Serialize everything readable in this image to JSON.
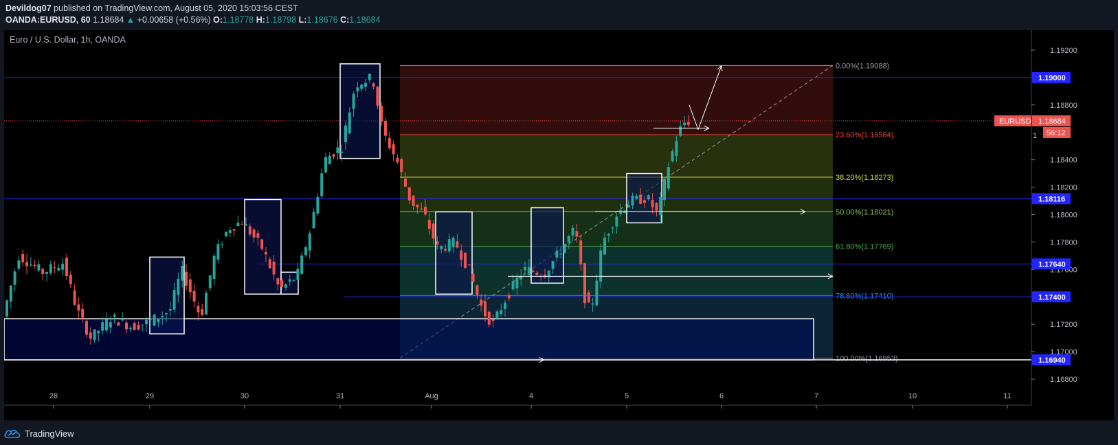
{
  "header": {
    "author": "Devildog07",
    "published_text": "published on TradingView.com, August 05, 2020 15:03:56 CEST",
    "symbol": "OANDA:EURUSD, 60",
    "last": "1.18684",
    "change": "+0.00658 (+0.56%)",
    "o_label": "O:",
    "o_value": "1.18778",
    "h_label": "H:",
    "h_value": "1.18798",
    "l_label": "L:",
    "l_value": "1.18676",
    "c_label": "C:",
    "c_value": "1.18684"
  },
  "chart": {
    "title": "Euro / U.S. Dollar, 1h, OANDA",
    "price_scale_labels": [
      "1.19200",
      "1.18800",
      "1.18400",
      "1.18200",
      "1.18000",
      "1.17800",
      "1.17600",
      "1.17200",
      "1.17000",
      "1.16800"
    ],
    "time_labels": [
      "28",
      "29",
      "30",
      "31",
      "Aug",
      "4",
      "5",
      "6",
      "7",
      "10",
      "11"
    ],
    "marked_levels": [
      {
        "label": "1.19000",
        "price": 1.19
      },
      {
        "label": "1.18116",
        "price": 1.18116
      },
      {
        "label": "1.17640",
        "price": 1.1764
      },
      {
        "label": "1.17400",
        "price": 1.174
      },
      {
        "label": "1.16940",
        "price": 1.1694
      }
    ],
    "current_price_tag": {
      "symbol": "EURUSD",
      "price": "1.18684",
      "countdown": "56:12",
      "partial_tick": "1"
    },
    "fib_levels": [
      {
        "label": "0.00%(1.19088)",
        "ratio": 0.0,
        "price": 1.19088,
        "color": "#9598a1"
      },
      {
        "label": "23.60%(1.18584)",
        "ratio": 0.236,
        "price": 1.18584,
        "color": "#f44336"
      },
      {
        "label": "38.20%(1.18273)",
        "ratio": 0.382,
        "price": 1.18273,
        "color": "#cddc39"
      },
      {
        "label": "50.00%(1.18021)",
        "ratio": 0.5,
        "price": 1.18021,
        "color": "#8bc34a"
      },
      {
        "label": "61.80%(1.17769)",
        "ratio": 0.618,
        "price": 1.17769,
        "color": "#4caf50"
      },
      {
        "label": "78.60%(1.17410)",
        "ratio": 0.786,
        "price": 1.1741,
        "color": "#2196f3"
      },
      {
        "label": "100.00%(1.16953)",
        "ratio": 1.0,
        "price": 1.16953,
        "color": "#9598a1"
      }
    ],
    "colors": {
      "background": "#000000",
      "up": "#26a69a",
      "down": "#ef5350",
      "level_line": "#2424ff",
      "label_bg": "#2424ff",
      "price_tag": "#ef5350"
    }
  },
  "footer": {
    "brand": "TradingView"
  }
}
